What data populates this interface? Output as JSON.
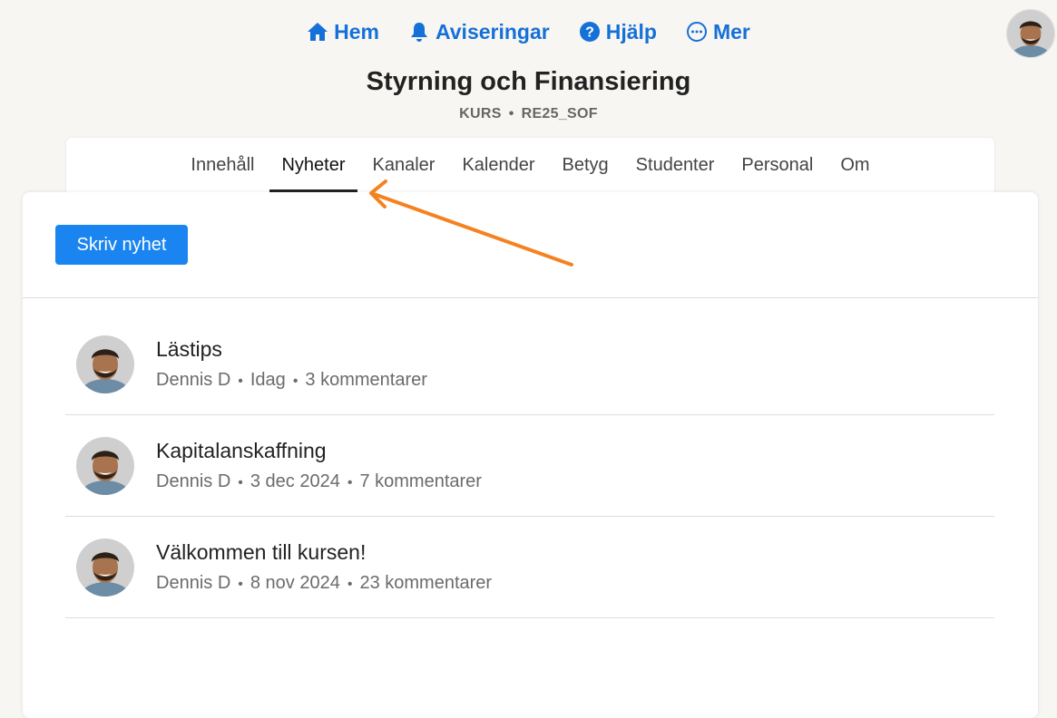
{
  "nav": {
    "home_label": "Hem",
    "notifications_label": "Aviseringar",
    "help_label": "Hjälp",
    "more_label": "Mer"
  },
  "course": {
    "title": "Styrning och Finansiering",
    "type": "KURS",
    "code": "RE25_SOF"
  },
  "tabs": [
    {
      "label": "Innehåll"
    },
    {
      "label": "Nyheter",
      "active": true
    },
    {
      "label": "Kanaler"
    },
    {
      "label": "Kalender"
    },
    {
      "label": "Betyg"
    },
    {
      "label": "Studenter"
    },
    {
      "label": "Personal"
    },
    {
      "label": "Om"
    }
  ],
  "actions": {
    "write_news_label": "Skriv nyhet"
  },
  "news": [
    {
      "title": "Lästips",
      "author": "Dennis D",
      "date": "Idag",
      "comments": "3 kommentarer"
    },
    {
      "title": "Kapitalanskaffning",
      "author": "Dennis D",
      "date": "3 dec 2024",
      "comments": "7 kommentarer"
    },
    {
      "title": "Välkommen till kursen!",
      "author": "Dennis D",
      "date": "8 nov 2024",
      "comments": "23 kommentarer"
    }
  ],
  "colors": {
    "accent": "#1570d8",
    "button": "#1a85f0",
    "annotation_arrow": "#f58220"
  }
}
